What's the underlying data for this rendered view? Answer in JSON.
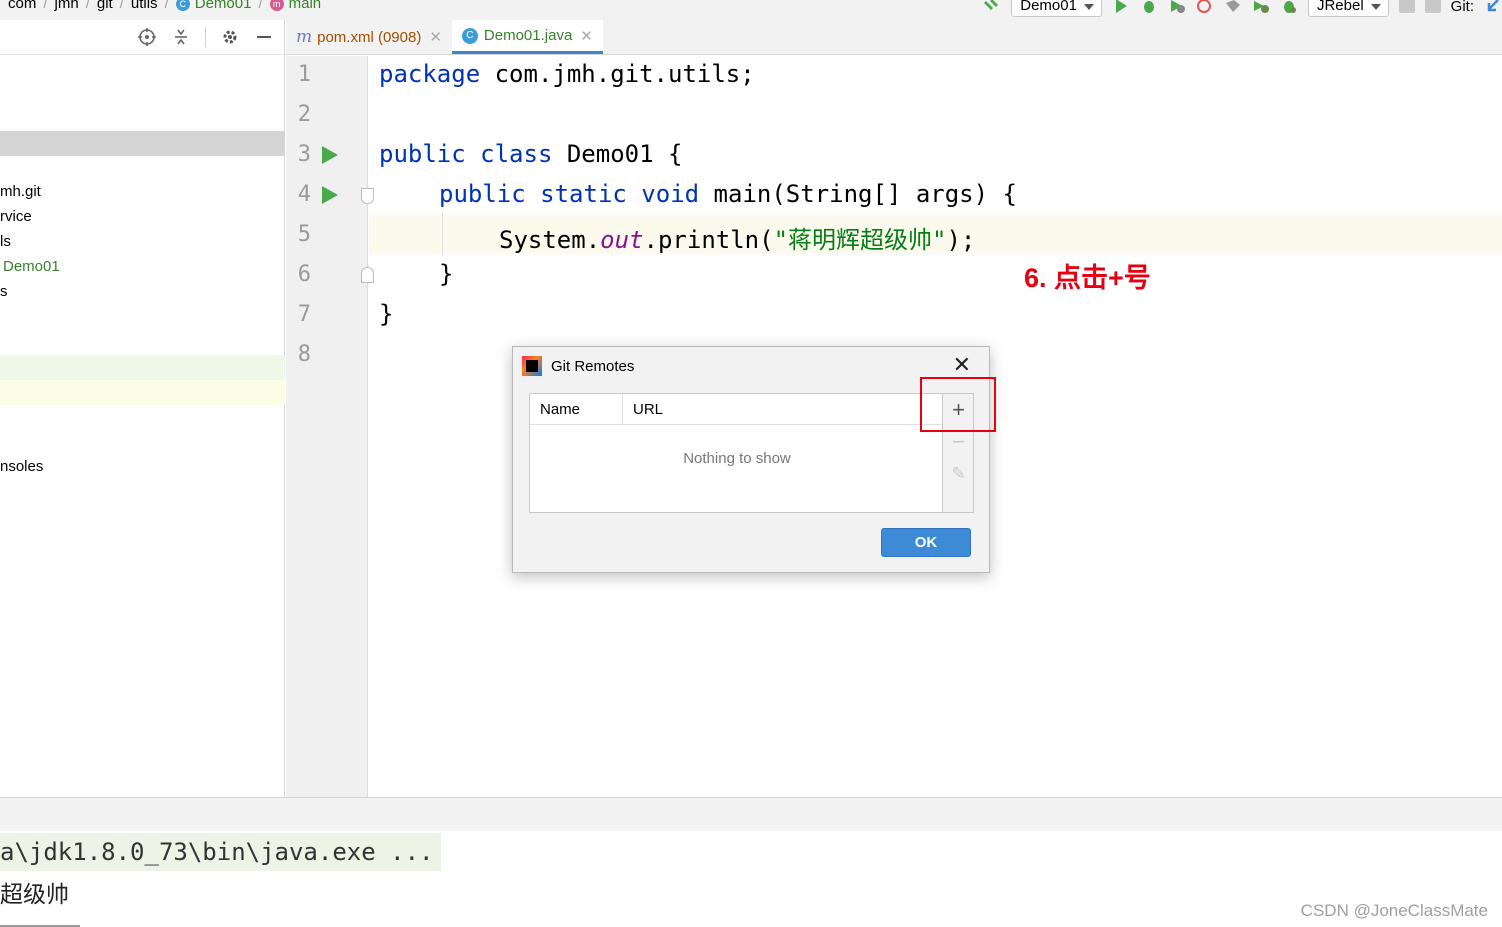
{
  "breadcrumb": {
    "items": [
      "com",
      "jmh",
      "git",
      "utils",
      "Demo01",
      "main"
    ]
  },
  "toolbar": {
    "run_config": "Demo01",
    "jrebel": "JRebel",
    "git_label": "Git:"
  },
  "project_tree": {
    "items": [
      "mh.git",
      "rvice",
      "ls",
      "Demo01",
      "s",
      "nsoles"
    ]
  },
  "tabs": [
    {
      "label": "pom.xml (0908)",
      "icon": "m"
    },
    {
      "label": "Demo01.java",
      "icon": "C"
    }
  ],
  "editor": {
    "line_numbers": [
      "1",
      "2",
      "3",
      "4",
      "5",
      "6",
      "7",
      "8"
    ],
    "code": {
      "l1_kw": "package",
      "l1_rest": " com.jmh.git.utils;",
      "l3_kw": "public class",
      "l3_rest": " Demo01 {",
      "l4_kw": "public static void",
      "l4_rest": " main(String[] args) {",
      "l5_a": "System.",
      "l5_out": "out",
      "l5_b": ".println(",
      "l5_str": "\"蒋明辉超级帅\"",
      "l5_c": ");",
      "l6": "}",
      "l7": "}"
    }
  },
  "annotation": "6. 点击+号",
  "dialog": {
    "title": "Git Remotes",
    "columns": [
      "Name",
      "URL"
    ],
    "empty_text": "Nothing to show",
    "ok_label": "OK",
    "add_symbol": "+",
    "remove_symbol": "−",
    "edit_symbol": "✎",
    "close_symbol": "✕"
  },
  "console": {
    "command": "a\\jdk1.8.0_73\\bin\\java.exe ...",
    "output": "超级帅"
  },
  "watermark": "CSDN @JoneClassMate",
  "colors": {
    "keyword": "#0033b3",
    "string": "#067d17",
    "field": "#871094",
    "annotation_red": "#e60012",
    "ok_button": "#3d8ad6"
  }
}
